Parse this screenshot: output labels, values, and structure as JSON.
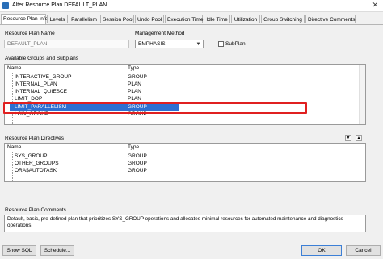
{
  "window": {
    "title": "Alter Resource Plan DEFAULT_PLAN",
    "close_glyph": "✕"
  },
  "tabs": [
    {
      "label": "Resource Plan Info"
    },
    {
      "label": "Levels"
    },
    {
      "label": "Parallelism"
    },
    {
      "label": "Session Pool"
    },
    {
      "label": "Undo Pool"
    },
    {
      "label": "Execution Time"
    },
    {
      "label": "Idle Time"
    },
    {
      "label": "Utilization"
    },
    {
      "label": "Group Switching"
    },
    {
      "label": "Directive Comments"
    }
  ],
  "form": {
    "plan_name_label": "Resource Plan Name",
    "plan_name_value": "DEFAULT_PLAN",
    "mgmt_method_label": "Management Method",
    "mgmt_method_value": "EMPHASIS",
    "subplan_label": "SubPlan"
  },
  "groups": {
    "section_label": "Available Groups and Subplans",
    "col_name": "Name",
    "col_type": "Type",
    "rows": [
      {
        "name": "INTERACTIVE_GROUP",
        "type": "GROUP"
      },
      {
        "name": "INTERNAL_PLAN",
        "type": "PLAN"
      },
      {
        "name": "INTERNAL_QUIESCE",
        "type": "PLAN"
      },
      {
        "name": "LIMIT_DOP",
        "type": "PLAN"
      },
      {
        "name": "LIMIT_PARALLELISM",
        "type": "GROUP"
      },
      {
        "name": "LOW_GROUP",
        "type": "GROUP"
      },
      {
        "name": "",
        "type": ""
      }
    ]
  },
  "directives": {
    "section_label": "Resource Plan Directives",
    "col_name": "Name",
    "col_type": "Type",
    "rows": [
      {
        "name": "SYS_GROUP",
        "type": "GROUP"
      },
      {
        "name": "OTHER_GROUPS",
        "type": "GROUP"
      },
      {
        "name": "ORA$AUTOTASK",
        "type": "GROUP"
      }
    ]
  },
  "comments": {
    "section_label": "Resource Plan Comments",
    "text": "Default, basic, pre-defined plan that prioritizes SYS_GROUP operations and allocates minimal resources for automated maintenance and diagnostics operations."
  },
  "buttons": {
    "show_sql": "Show SQL",
    "schedule": "Schedule...",
    "ok": "OK",
    "cancel": "Cancel"
  }
}
